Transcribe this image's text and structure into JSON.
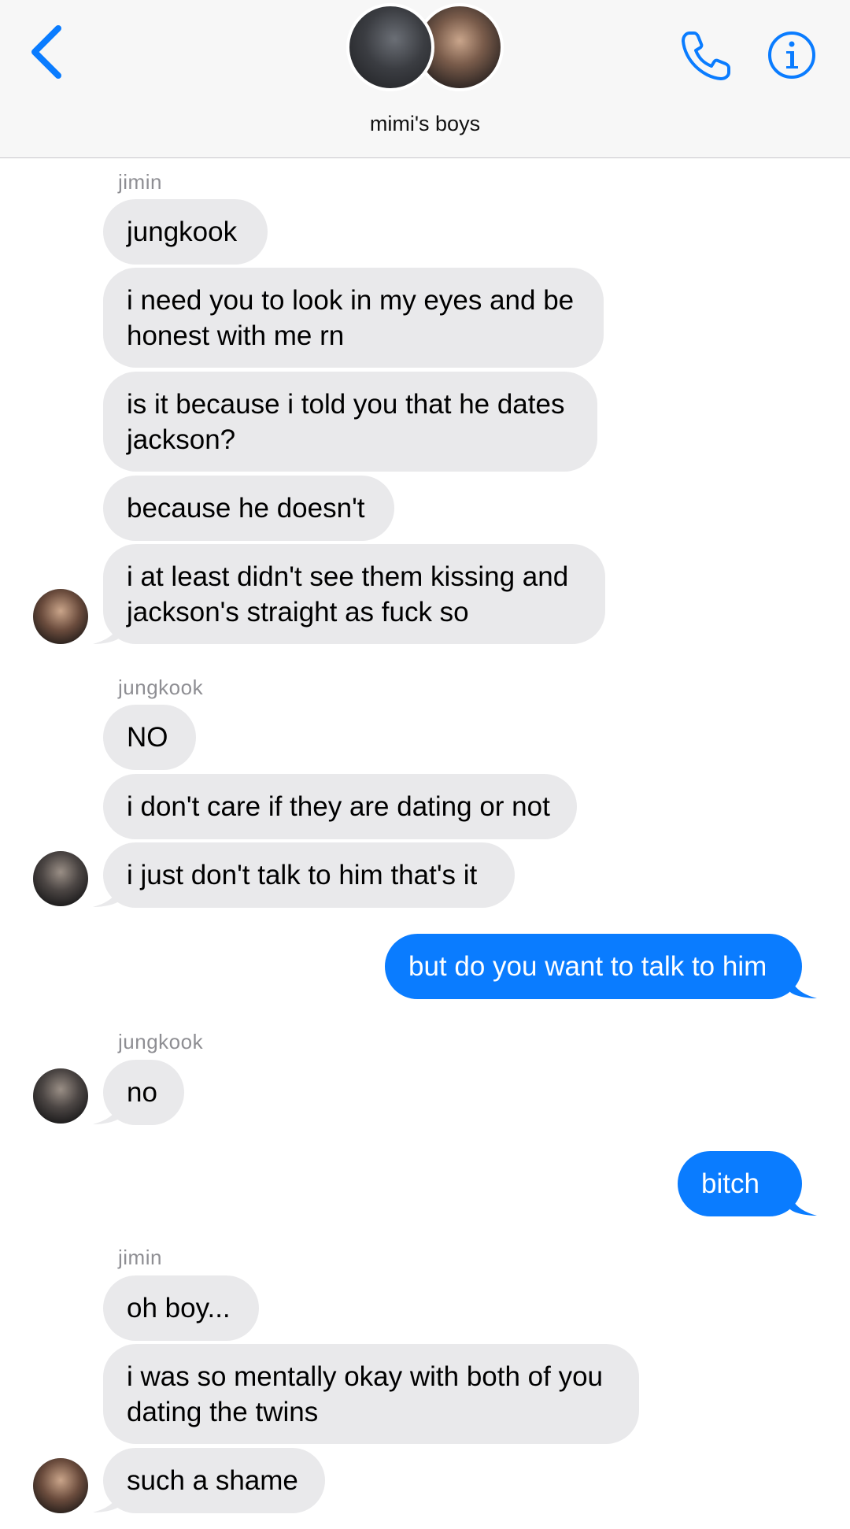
{
  "header": {
    "group_name": "mimi's boys",
    "icons": {
      "back": "chevron-left-icon",
      "call": "phone-icon",
      "info": "info-icon"
    },
    "accent_color": "#0a7cff"
  },
  "messages": [
    {
      "sender": "jimin"
    },
    {
      "text": "jungkook"
    },
    {
      "text": "i need you to look in my eyes and be"
    },
    {
      "text": "honest with me rn"
    },
    {
      "text": "is it because i told you that he dates"
    },
    {
      "text": "jackson?"
    },
    {
      "text": "because he doesn't"
    },
    {
      "text": "i at least didn't see them kissing and"
    },
    {
      "text": "jackson's straight as fuck so"
    },
    {
      "sender": "jungkook"
    },
    {
      "text": "NO"
    },
    {
      "text": "i don't care if they are dating or not"
    },
    {
      "text": "i just don't talk to him that's it"
    },
    {
      "text": "but do you want to talk to him"
    },
    {
      "sender": "jungkook"
    },
    {
      "text": "no"
    },
    {
      "text": "bitch"
    },
    {
      "sender": "jimin"
    },
    {
      "text": "oh boy..."
    },
    {
      "text": "i was so mentally okay with both of you"
    },
    {
      "text": "dating the twins"
    },
    {
      "text": "such a shame"
    }
  ]
}
